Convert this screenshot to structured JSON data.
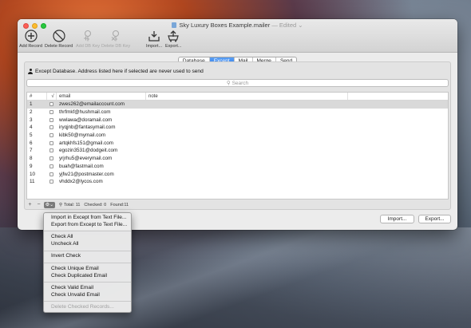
{
  "window": {
    "title": "Sky Luxury Boxes Example.mailer",
    "edited": "— Edited",
    "chevron": "⌄"
  },
  "toolbar": [
    {
      "label": "Add Record",
      "icon": "plus-circle-icon",
      "enabled": true
    },
    {
      "label": "Delete Record",
      "icon": "prohibit-icon",
      "enabled": true
    },
    {
      "label": "Add DB Key",
      "icon": "add-key-icon",
      "enabled": false
    },
    {
      "label": "Delete DB Key",
      "icon": "delete-key-icon",
      "enabled": false
    },
    {
      "label": "Import...",
      "icon": "import-tray-icon",
      "enabled": true
    },
    {
      "label": "Export...",
      "icon": "export-cart-icon",
      "enabled": true
    }
  ],
  "tabs": [
    "Database",
    "Except",
    "Mail",
    "Merge",
    "Send"
  ],
  "active_tab": "Except",
  "notice": "Except Database. Address listed here if selected are never used to send",
  "search": {
    "placeholder": "Search"
  },
  "table": {
    "headers": [
      "#",
      "√",
      "email",
      "note"
    ],
    "rows": [
      {
        "num": "1",
        "email": "zwes262@emailaccount.com"
      },
      {
        "num": "2",
        "email": "thrfmkf@hushmail.com"
      },
      {
        "num": "3",
        "email": "wwlawa@doramail.com"
      },
      {
        "num": "4",
        "email": "iryqjnb@fantasymail.com"
      },
      {
        "num": "5",
        "email": "kibk50@mymail.com"
      },
      {
        "num": "6",
        "email": "artqkhfs151@gmail.com"
      },
      {
        "num": "7",
        "email": "egozin3531@dodgeit.com"
      },
      {
        "num": "8",
        "email": "yrjrhu5@everymail.com"
      },
      {
        "num": "9",
        "email": "buah@fastmail.com"
      },
      {
        "num": "10",
        "email": "yjfw21@postmaster.com"
      },
      {
        "num": "11",
        "email": "vhddx2@lycos.com"
      }
    ]
  },
  "status": {
    "total": "Total: 11",
    "checked": "Checked: 0",
    "found": "Found:11"
  },
  "buttons": {
    "import": "Import...",
    "export": "Export..."
  },
  "menu": {
    "groups": [
      [
        "Import in Except from Text File...",
        "Export from Except to Text File..."
      ],
      [
        "Check All",
        "Uncheck All"
      ],
      [
        "Invert Check"
      ],
      [
        "Check Unique Email",
        "Check Duplicated Email"
      ],
      [
        "Check Valid  Email",
        "Check Unvalid  Email"
      ]
    ],
    "disabled_item": "Delete Checked Records..."
  }
}
